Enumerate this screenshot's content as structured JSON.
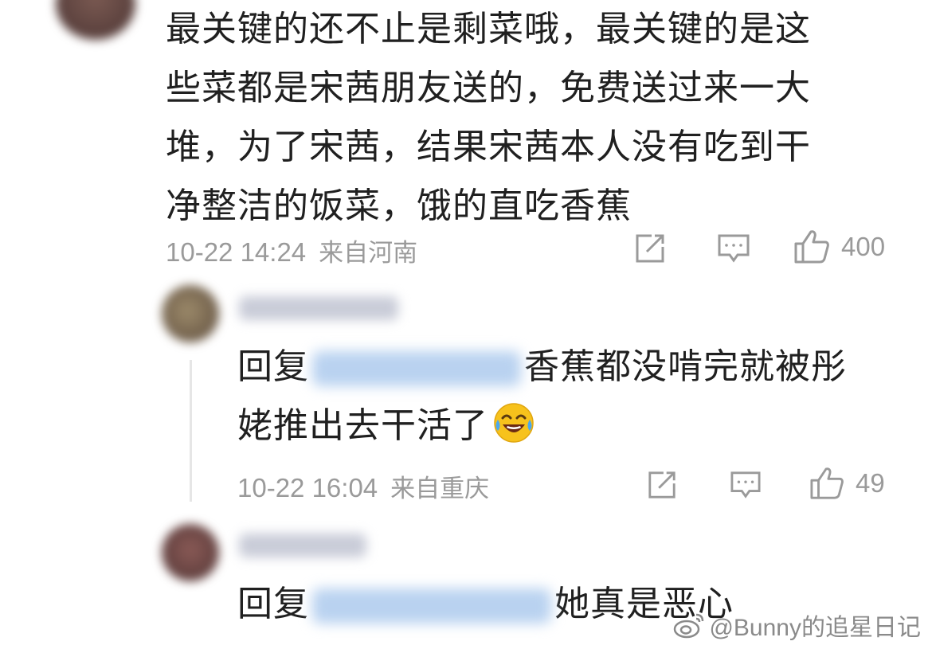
{
  "comment": {
    "text": "最关键的还不止是剩菜哦，最关键的是这些菜都是宋茜朋友送的，免费送过来一大堆，为了宋茜，结果宋茜本人没有吃到干净整洁的饭菜，饿的直吃香蕉",
    "lines": [
      "最关键的还不止是剩菜哦，最关键的是这",
      "些菜都是宋茜朋友送的，免费送过来一大",
      "堆，为了宋茜，结果宋茜本人没有吃到干",
      "净整洁的饭菜，饿的直吃香蕉"
    ],
    "time": "10-22 14:24",
    "location": "来自河南",
    "likes": "400"
  },
  "replies": [
    {
      "prefix": "回复",
      "text_line1": "香蕉都没啃完就被彤",
      "text_line2": "姥推出去干活了",
      "emoji": "laughing-tears-emoji",
      "time": "10-22 16:04",
      "location": "来自重庆",
      "likes": "49"
    },
    {
      "prefix": "回复",
      "text_line1": "她真是恶心"
    }
  ],
  "watermark": "@Bunny的追星日记",
  "colors": {
    "text": "#202020",
    "meta": "#9a9a9a",
    "mention": "#b9d2f0",
    "thread_line": "#e6e6e6"
  },
  "icons": [
    "share-icon",
    "comment-icon",
    "like-icon",
    "weibo-logo-icon"
  ]
}
